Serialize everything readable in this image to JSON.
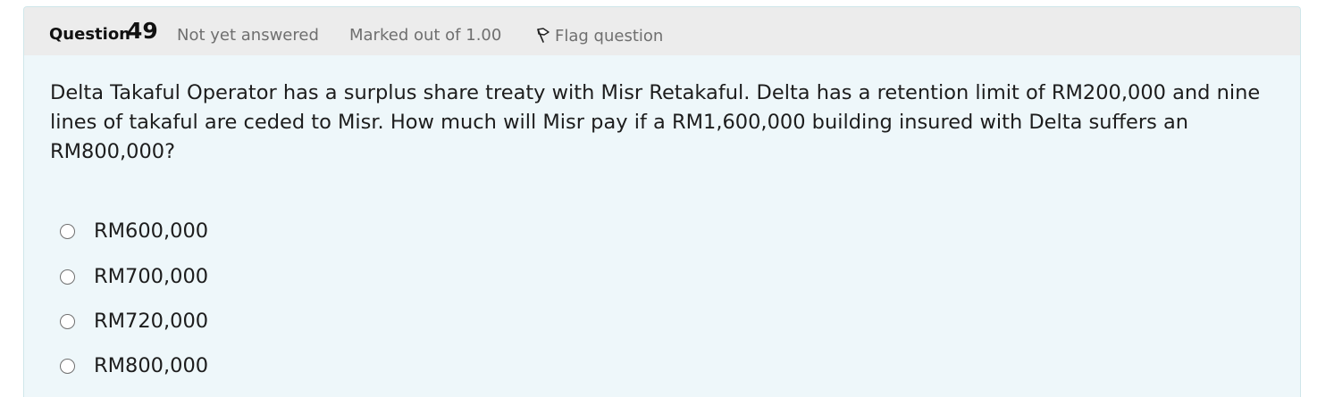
{
  "question": {
    "label": "Question",
    "number": "49",
    "state": "Not yet answered",
    "grade": "Marked out of 1.00",
    "flag_label": "Flag question",
    "flag_icon": "flag-icon",
    "text": "Delta Takaful Operator has a surplus share treaty with Misr Retakaful. Delta has a retention limit of RM200,000 and nine lines of takaful are ceded to Misr. How much will Misr pay if a RM1,600,000 building insured with Delta suffers an RM800,000?"
  },
  "answers": [
    {
      "label": "RM600,000"
    },
    {
      "label": "RM700,000"
    },
    {
      "label": "RM720,000"
    },
    {
      "label": "RM800,000"
    }
  ],
  "colors": {
    "info_bar": "#ececec",
    "content_background": "#eef7fa",
    "muted_text": "#6f6f6f",
    "body_text": "#1d1d1d"
  }
}
